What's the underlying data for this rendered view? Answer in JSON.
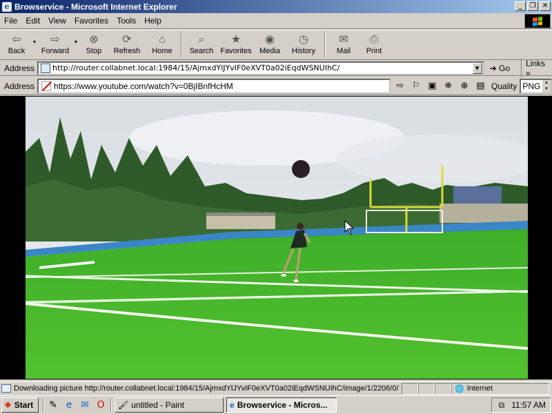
{
  "window": {
    "title": "Browservice - Microsoft Internet Explorer",
    "app_icon": "ie-icon",
    "buttons": [
      "minimize",
      "maximize",
      "close"
    ]
  },
  "menu": {
    "items": [
      "File",
      "Edit",
      "View",
      "Favorites",
      "Tools",
      "Help"
    ]
  },
  "toolbar": {
    "buttons": [
      {
        "label": "Back",
        "icon": "back-arrow-icon",
        "dropdown": true
      },
      {
        "label": "Forward",
        "icon": "forward-arrow-icon",
        "dropdown": true
      },
      {
        "label": "Stop",
        "icon": "stop-icon"
      },
      {
        "label": "Refresh",
        "icon": "refresh-icon"
      },
      {
        "label": "Home",
        "icon": "home-icon"
      },
      {
        "label": "Search",
        "icon": "search-icon"
      },
      {
        "label": "Favorites",
        "icon": "favorites-icon"
      },
      {
        "label": "Media",
        "icon": "media-icon"
      },
      {
        "label": "History",
        "icon": "history-icon"
      },
      {
        "label": "Mail",
        "icon": "mail-icon",
        "dropdown": true
      },
      {
        "label": "Print",
        "icon": "print-icon"
      }
    ]
  },
  "address": {
    "label": "Address",
    "url": "http://router.collabnet.local:1984/15/AjmxdYlJYvIF0eXVT0a02iEqdWSNUIhC/",
    "go_label": "Go",
    "links_label": "Links"
  },
  "inner_address": {
    "label": "Address",
    "url": "https://www.youtube.com/watch?v=0BjIBnfHcHM",
    "quality_label": "Quality",
    "quality_value": "PNG"
  },
  "status": {
    "text": "Downloading picture http://router.collabnet.local:1984/15/AjmxdYlJYvIF0eXVT0a02iEqdWSNUIhC/image/1/2206/0/",
    "zone": "Internet"
  },
  "taskbar": {
    "start_label": "Start",
    "tasks": [
      {
        "label": "untitled - Paint",
        "active": false
      },
      {
        "label": "Browservice - Micros...",
        "active": true
      }
    ],
    "clock": "11:57 AM"
  }
}
